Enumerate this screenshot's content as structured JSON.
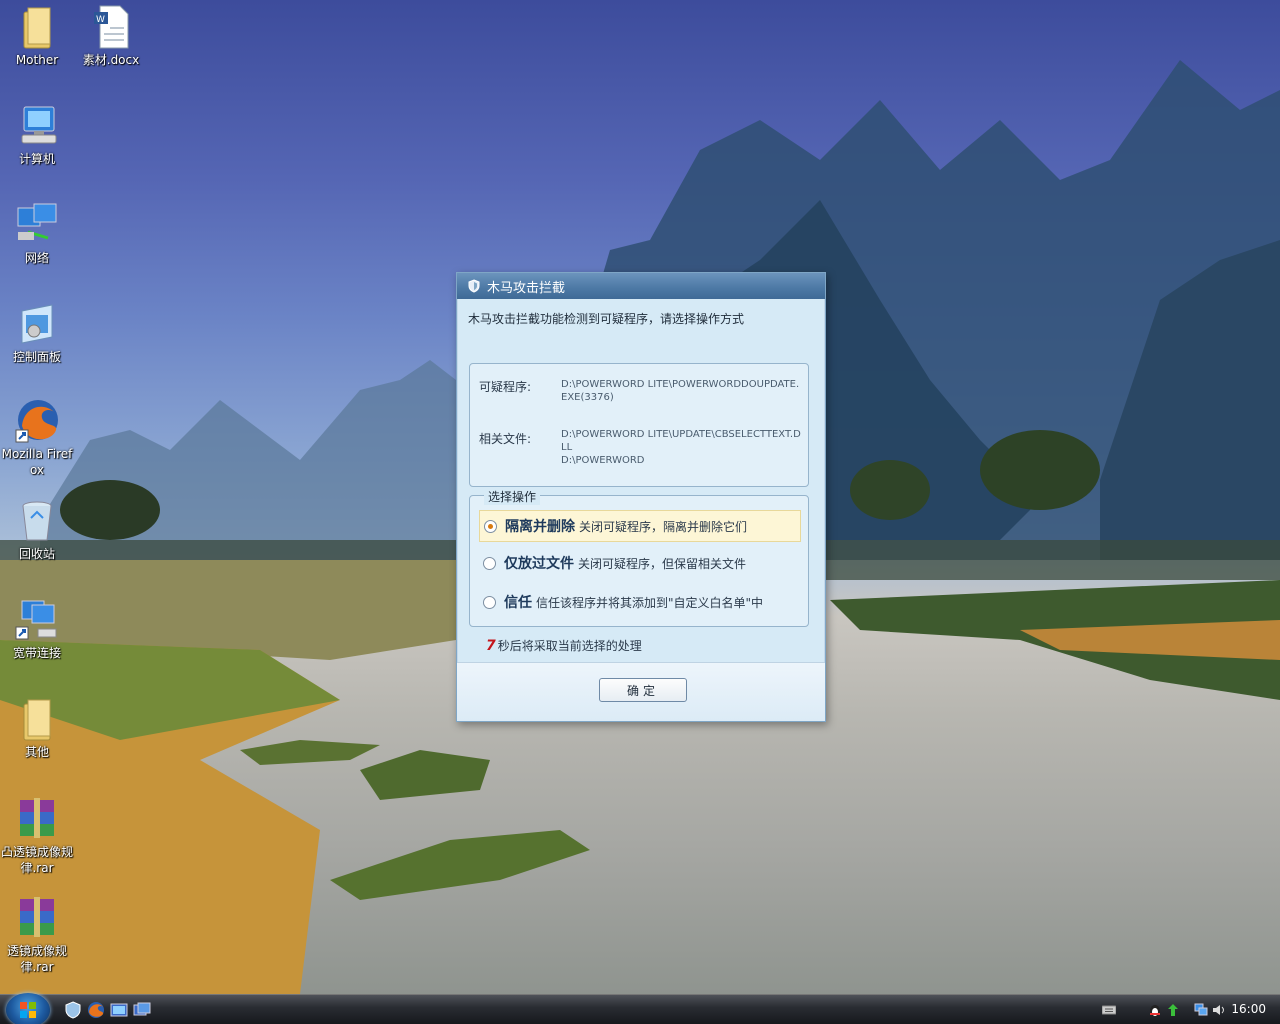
{
  "desktop": {
    "icons": [
      {
        "label": "Mother"
      },
      {
        "label": "素材.docx"
      },
      {
        "label": "计算机"
      },
      {
        "label": "网络"
      },
      {
        "label": "控制面板"
      },
      {
        "label": "Mozilla Firefox"
      },
      {
        "label": "回收站"
      },
      {
        "label": "宽带连接"
      },
      {
        "label": "其他"
      },
      {
        "label": "凸透镜成像规律.rar"
      },
      {
        "label": "透镜成像规律.rar"
      }
    ]
  },
  "dialog": {
    "title": "木马攻击拦截",
    "intro": "木马攻击拦截功能检测到可疑程序，请选择操作方式",
    "suspicious_label": "可疑程序:",
    "suspicious_value": "D:\\POWERWORD LITE\\POWERWORDDOUPDATE.EXE(3376)",
    "related_label": "相关文件:",
    "related_value_1": "D:\\POWERWORD LITE\\UPDATE\\CBSELECTTEXT.DLL",
    "related_value_2": "D:\\POWERWORD",
    "ops_legend": "选择操作",
    "options": [
      {
        "title": "隔离并删除",
        "desc": "关闭可疑程序，隔离并删除它们",
        "selected": true
      },
      {
        "title": "仅放过文件",
        "desc": "关闭可疑程序，但保留相关文件",
        "selected": false
      },
      {
        "title": "信任",
        "desc": "信任该程序并将其添加到\"自定义白名单\"中",
        "selected": false
      }
    ],
    "countdown_number": "7",
    "countdown_text": "秒后将采取当前选择的处理",
    "ok_label": "确定"
  },
  "taskbar": {
    "clock": "16:00"
  },
  "colors": {
    "titlebar": "#4e7aa6",
    "dialog_bg": "#d6eaf6",
    "selected_option_bg": "#fdf6d6",
    "countdown_accent": "#c4161c"
  }
}
